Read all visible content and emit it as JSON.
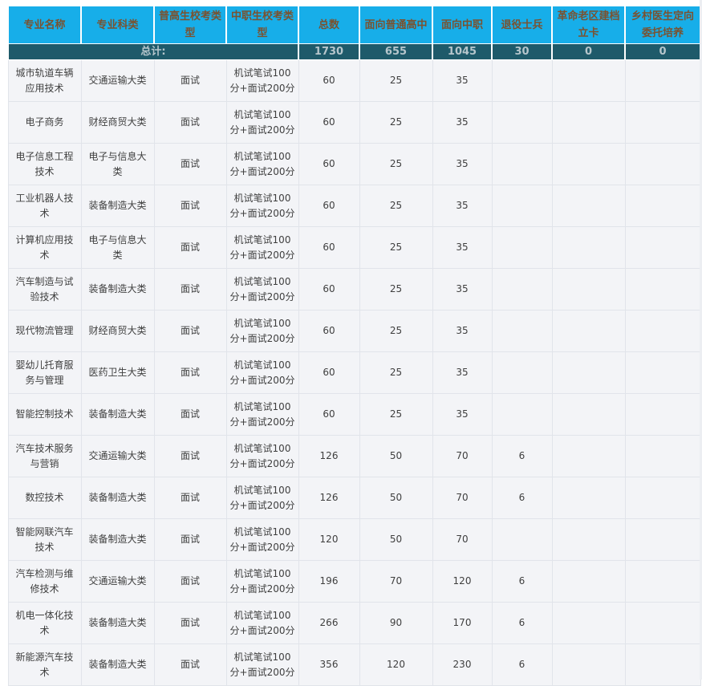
{
  "headers": [
    "专业名称",
    "专业科类",
    "普高生校考类型",
    "中职生校考类型",
    "总数",
    "面向普通高中",
    "面向中职",
    "退役士兵",
    "革命老区建档立卡",
    "乡村医生定向委托培养"
  ],
  "total": {
    "label": "总计:",
    "values": [
      "1730",
      "655",
      "1045",
      "30",
      "0",
      "0"
    ]
  },
  "rows": [
    {
      "name": "城市轨道车辆应用技术",
      "category": "交通运输大类",
      "pg": "面试",
      "zz": "机试笔试100分+面试200分",
      "total": "60",
      "gz": "25",
      "zhongzhi": "35",
      "tuiyi": "",
      "gm": "",
      "xc": ""
    },
    {
      "name": "电子商务",
      "category": "财经商贸大类",
      "pg": "面试",
      "zz": "机试笔试100分+面试200分",
      "total": "60",
      "gz": "25",
      "zhongzhi": "35",
      "tuiyi": "",
      "gm": "",
      "xc": ""
    },
    {
      "name": "电子信息工程技术",
      "category": "电子与信息大类",
      "pg": "面试",
      "zz": "机试笔试100分+面试200分",
      "total": "60",
      "gz": "25",
      "zhongzhi": "35",
      "tuiyi": "",
      "gm": "",
      "xc": ""
    },
    {
      "name": "工业机器人技术",
      "category": "装备制造大类",
      "pg": "面试",
      "zz": "机试笔试100分+面试200分",
      "total": "60",
      "gz": "25",
      "zhongzhi": "35",
      "tuiyi": "",
      "gm": "",
      "xc": ""
    },
    {
      "name": "计算机应用技术",
      "category": "电子与信息大类",
      "pg": "面试",
      "zz": "机试笔试100分+面试200分",
      "total": "60",
      "gz": "25",
      "zhongzhi": "35",
      "tuiyi": "",
      "gm": "",
      "xc": ""
    },
    {
      "name": "汽车制造与试验技术",
      "category": "装备制造大类",
      "pg": "面试",
      "zz": "机试笔试100分+面试200分",
      "total": "60",
      "gz": "25",
      "zhongzhi": "35",
      "tuiyi": "",
      "gm": "",
      "xc": ""
    },
    {
      "name": "现代物流管理",
      "category": "财经商贸大类",
      "pg": "面试",
      "zz": "机试笔试100分+面试200分",
      "total": "60",
      "gz": "25",
      "zhongzhi": "35",
      "tuiyi": "",
      "gm": "",
      "xc": ""
    },
    {
      "name": "婴幼儿托育服务与管理",
      "category": "医药卫生大类",
      "pg": "面试",
      "zz": "机试笔试100分+面试200分",
      "total": "60",
      "gz": "25",
      "zhongzhi": "35",
      "tuiyi": "",
      "gm": "",
      "xc": ""
    },
    {
      "name": "智能控制技术",
      "category": "装备制造大类",
      "pg": "面试",
      "zz": "机试笔试100分+面试200分",
      "total": "60",
      "gz": "25",
      "zhongzhi": "35",
      "tuiyi": "",
      "gm": "",
      "xc": ""
    },
    {
      "name": "汽车技术服务与营销",
      "category": "交通运输大类",
      "pg": "面试",
      "zz": "机试笔试100分+面试200分",
      "total": "126",
      "gz": "50",
      "zhongzhi": "70",
      "tuiyi": "6",
      "gm": "",
      "xc": ""
    },
    {
      "name": "数控技术",
      "category": "装备制造大类",
      "pg": "面试",
      "zz": "机试笔试100分+面试200分",
      "total": "126",
      "gz": "50",
      "zhongzhi": "70",
      "tuiyi": "6",
      "gm": "",
      "xc": ""
    },
    {
      "name": "智能网联汽车技术",
      "category": "装备制造大类",
      "pg": "面试",
      "zz": "机试笔试100分+面试200分",
      "total": "120",
      "gz": "50",
      "zhongzhi": "70",
      "tuiyi": "",
      "gm": "",
      "xc": ""
    },
    {
      "name": "汽车检测与维修技术",
      "category": "交通运输大类",
      "pg": "面试",
      "zz": "机试笔试100分+面试200分",
      "total": "196",
      "gz": "70",
      "zhongzhi": "120",
      "tuiyi": "6",
      "gm": "",
      "xc": ""
    },
    {
      "name": "机电一体化技术",
      "category": "装备制造大类",
      "pg": "面试",
      "zz": "机试笔试100分+面试200分",
      "total": "266",
      "gz": "90",
      "zhongzhi": "170",
      "tuiyi": "6",
      "gm": "",
      "xc": ""
    },
    {
      "name": "新能源汽车技术",
      "category": "装备制造大类",
      "pg": "面试",
      "zz": "机试笔试100分+面试200分",
      "total": "356",
      "gz": "120",
      "zhongzhi": "230",
      "tuiyi": "6",
      "gm": "",
      "xc": ""
    }
  ]
}
